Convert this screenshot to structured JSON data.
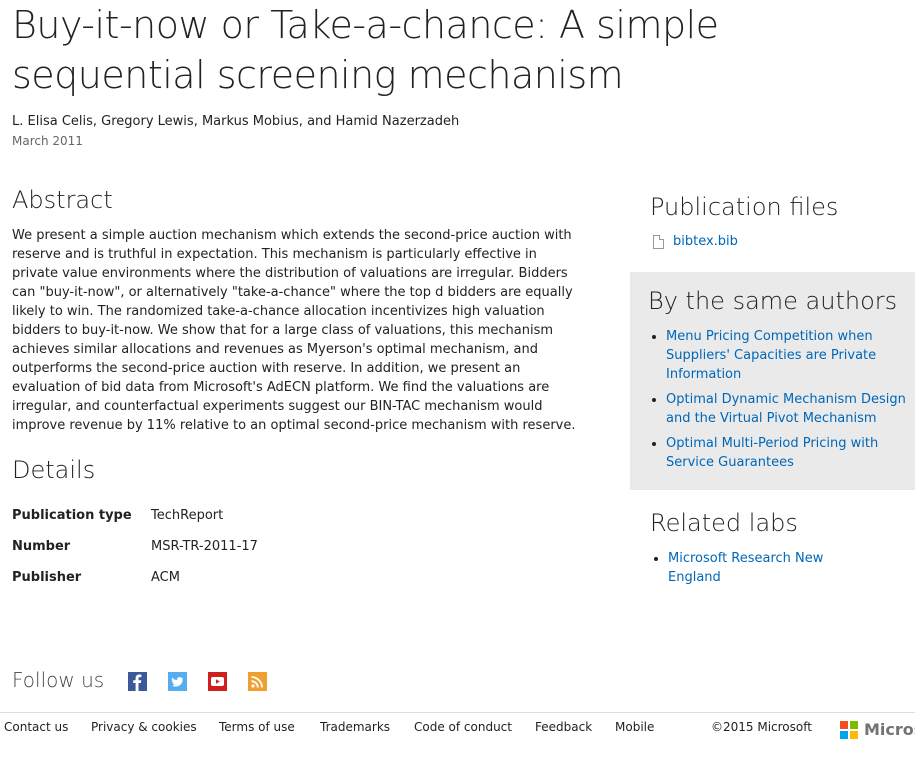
{
  "paper": {
    "title": "Buy-it-now or Take-a-chance: A simple sequential screening mechanism",
    "authors": "L. Elisa Celis, Gregory Lewis, Markus Mobius, and Hamid Nazerzadeh",
    "date": "March 2011"
  },
  "abstract": {
    "heading": "Abstract",
    "text": "We present a simple auction mechanism which extends the second-price auction with reserve and is truthful in expectation. This mechanism is particularly effective in private value environments where the distribution of valuations are irregular. Bidders can \"buy-it-now\", or alternatively \"take-a-chance\" where the top d bidders are equally likely to win. The randomized take-a-chance allocation incentivizes high valuation bidders to buy-it-now. We show that for a large class of valuations, this mechanism achieves similar allocations and revenues as Myerson's optimal mechanism, and outperforms the second-price auction with reserve. In addition, we present an evaluation of bid data from Microsoft's AdECN platform. We find the valuations are irregular, and counterfactual experiments suggest our BIN-TAC mechanism would improve revenue by 11% relative to an optimal second-price mechanism with reserve."
  },
  "details": {
    "heading": "Details",
    "rows": [
      {
        "key": "Publication type",
        "value": "TechReport"
      },
      {
        "key": "Number",
        "value": "MSR-TR-2011-17"
      },
      {
        "key": "Publisher",
        "value": "ACM"
      }
    ]
  },
  "sidebar": {
    "files_heading": "Publication files",
    "files": [
      {
        "label": "bibtex.bib",
        "icon": "file-icon"
      }
    ],
    "same_authors_heading": "By the same authors",
    "same_authors": [
      "Menu Pricing Competition when Suppliers' Capacities are Private Information",
      "Optimal Dynamic Mechanism Design and the Virtual Pivot Mechanism",
      "Optimal Multi-Period Pricing with Service Guarantees"
    ],
    "labs_heading": "Related labs",
    "labs": [
      "Microsoft Research New England"
    ]
  },
  "follow": {
    "label": "Follow us",
    "icons": [
      "facebook-icon",
      "twitter-icon",
      "youtube-icon",
      "rss-icon"
    ]
  },
  "footer": {
    "links": [
      "Contact us",
      "Privacy & cookies",
      "Terms of use",
      "Trademarks",
      "Code of conduct",
      "Feedback",
      "Mobile"
    ],
    "copyright": "©2015 Microsoft",
    "logo_text": "Microsoft"
  },
  "colors": {
    "link": "#0067b8",
    "sidebar_bg": "#eaeaea",
    "ms_red": "#f25022",
    "ms_green": "#7fba00",
    "ms_blue": "#00a4ef",
    "ms_yellow": "#ffb900"
  }
}
